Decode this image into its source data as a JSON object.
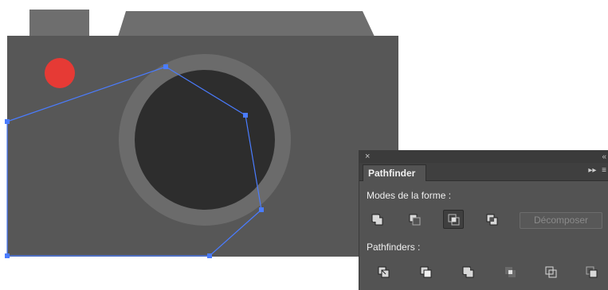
{
  "panel": {
    "close_glyph": "×",
    "collapse_glyph": "«",
    "tab_label": "Pathfinder",
    "menu_glyph": "▸▸",
    "options_glyph": "≡",
    "modes_label": "Modes de la forme :",
    "pathfinders_label": "Pathfinders :",
    "expand_label": "Décomposer",
    "shape_modes": [
      {
        "name": "unite-icon"
      },
      {
        "name": "minus-front-icon"
      },
      {
        "name": "intersect-icon",
        "active": true
      },
      {
        "name": "exclude-icon"
      }
    ],
    "pathfinder_ops": [
      {
        "name": "divide-icon"
      },
      {
        "name": "trim-icon"
      },
      {
        "name": "merge-icon"
      },
      {
        "name": "crop-icon"
      },
      {
        "name": "outline-icon"
      },
      {
        "name": "minus-back-icon"
      }
    ]
  },
  "colors": {
    "camera_body": "#575757",
    "camera_top": "#6e6e6e",
    "lens_ring": "#6b6b6b",
    "lens_inner": "#2d2d2d",
    "red_dot": "#e63a35",
    "selection": "#4a7cff",
    "panel_bg": "#535353"
  }
}
